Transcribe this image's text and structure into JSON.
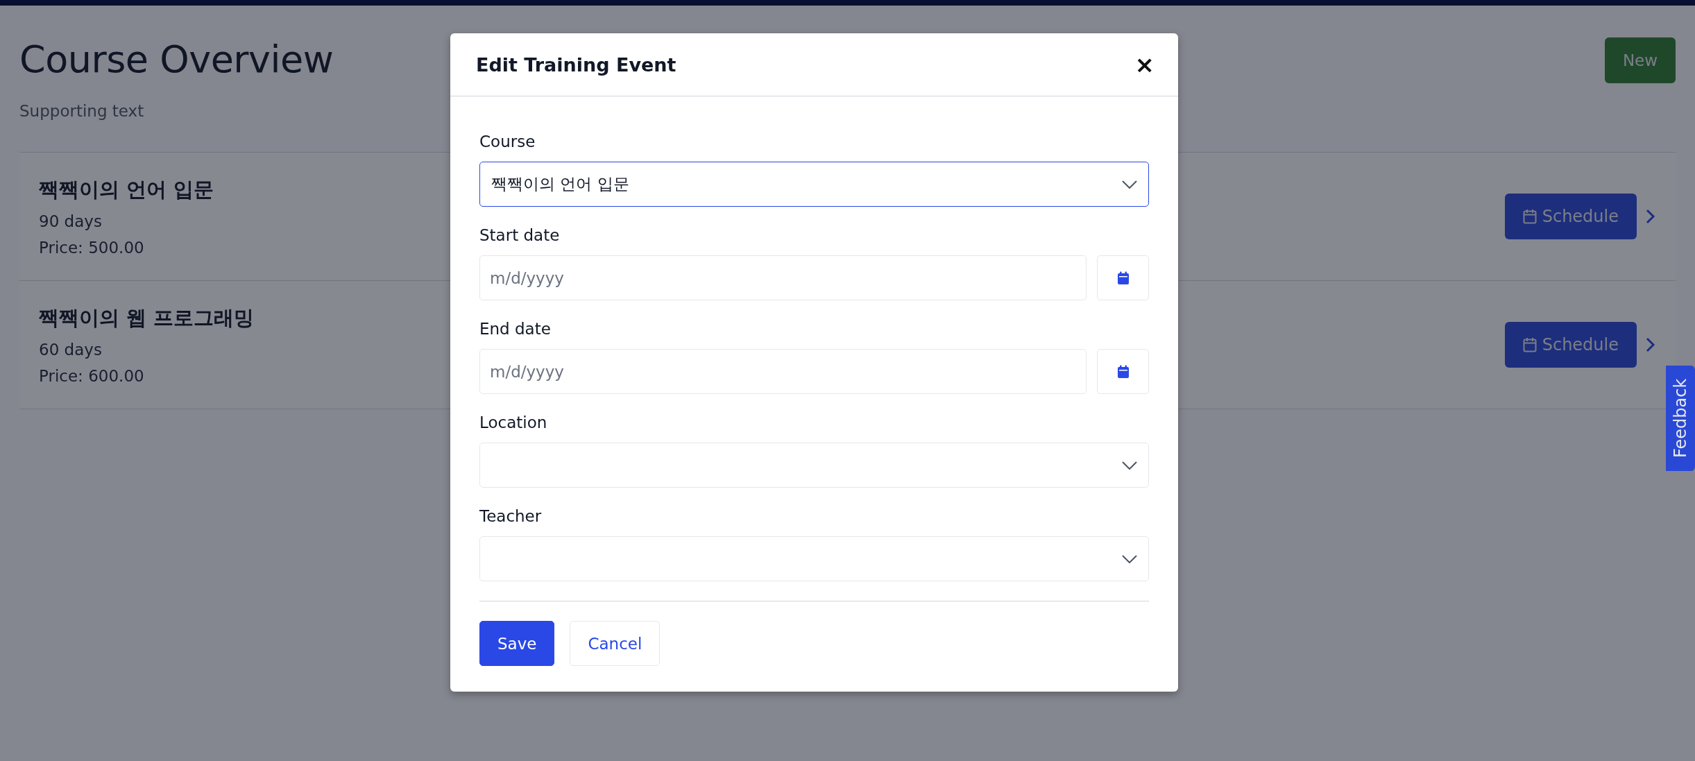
{
  "page": {
    "title": "Course Overview",
    "subtitle": "Supporting text",
    "new_button": "New"
  },
  "courses": [
    {
      "name": "짹짹이의 언어 입문",
      "duration": "90 days",
      "price": "Price: 500.00",
      "action": "Schedule"
    },
    {
      "name": "짹짹이의 웹 프로그래밍",
      "duration": "60 days",
      "price": "Price: 600.00",
      "action": "Schedule"
    }
  ],
  "feedback_tab": "Feedback",
  "dialog": {
    "title": "Edit Training Event",
    "close": "×",
    "fields": [
      {
        "kind": "select",
        "label": "Course",
        "value": "짹짹이의 언어 입문",
        "focused": true
      },
      {
        "kind": "date",
        "label": "Start date",
        "placeholder": "m/d/yyyy",
        "focused": false
      },
      {
        "kind": "date",
        "label": "End date",
        "placeholder": "m/d/yyyy",
        "focused": false
      },
      {
        "kind": "select",
        "label": "Location",
        "focused": false
      },
      {
        "kind": "select",
        "label": "Teacher",
        "focused": false
      }
    ],
    "buttons": [
      {
        "label": "Save",
        "primary": true
      },
      {
        "label": "Cancel",
        "primary": false
      }
    ]
  }
}
